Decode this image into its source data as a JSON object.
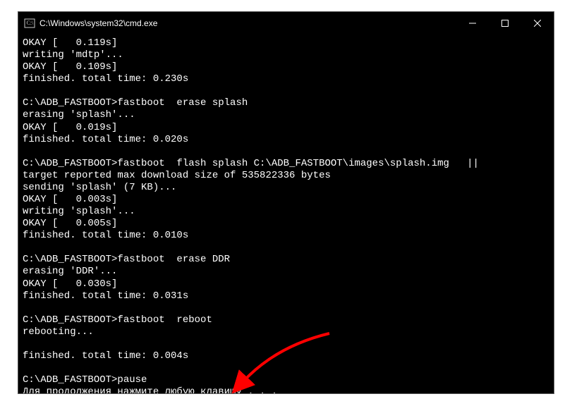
{
  "window": {
    "title": "C:\\Windows\\system32\\cmd.exe"
  },
  "terminal": {
    "lines": [
      "OKAY [   0.119s]",
      "writing 'mdtp'...",
      "OKAY [   0.109s]",
      "finished. total time: 0.230s",
      "",
      "C:\\ADB_FASTBOOT>fastboot  erase splash",
      "erasing 'splash'...",
      "OKAY [   0.019s]",
      "finished. total time: 0.020s",
      "",
      "C:\\ADB_FASTBOOT>fastboot  flash splash C:\\ADB_FASTBOOT\\images\\splash.img   ||",
      "target reported max download size of 535822336 bytes",
      "sending 'splash' (7 KB)...",
      "OKAY [   0.003s]",
      "writing 'splash'...",
      "OKAY [   0.005s]",
      "finished. total time: 0.010s",
      "",
      "C:\\ADB_FASTBOOT>fastboot  erase DDR",
      "erasing 'DDR'...",
      "OKAY [   0.030s]",
      "finished. total time: 0.031s",
      "",
      "C:\\ADB_FASTBOOT>fastboot  reboot",
      "rebooting...",
      "",
      "finished. total time: 0.004s",
      "",
      "C:\\ADB_FASTBOOT>pause",
      "Для продолжения нажмите любую клавишу . . ."
    ]
  },
  "annotation": {
    "arrow_color": "#ff0000"
  }
}
